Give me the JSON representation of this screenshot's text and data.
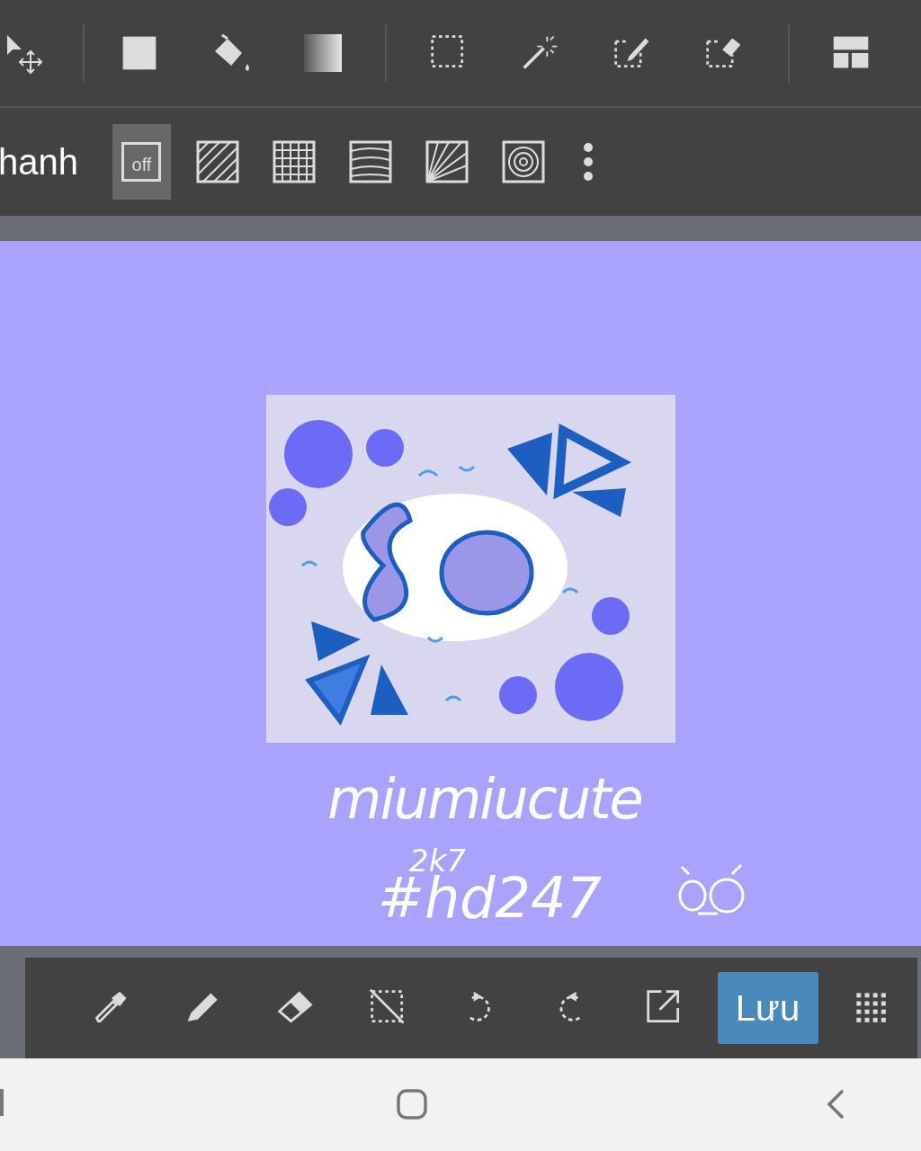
{
  "top_toolbar": {
    "groups": [
      {
        "tools": [
          {
            "kind": "move"
          }
        ]
      },
      {
        "tools": [
          {
            "kind": "fill-rect"
          },
          {
            "kind": "bucket"
          },
          {
            "kind": "gradient"
          }
        ]
      },
      {
        "tools": [
          {
            "kind": "select-rect"
          },
          {
            "kind": "magic-wand"
          },
          {
            "kind": "select-pen"
          },
          {
            "kind": "select-eraser"
          }
        ]
      },
      {
        "tools": [
          {
            "kind": "layout"
          }
        ]
      }
    ]
  },
  "pattern_bar": {
    "label": "hanh",
    "tiles": [
      {
        "kind": "off",
        "text": "off",
        "selected": true
      },
      {
        "kind": "diagonal",
        "selected": false
      },
      {
        "kind": "grid",
        "selected": false
      },
      {
        "kind": "wavy",
        "selected": false
      },
      {
        "kind": "rays",
        "selected": false
      },
      {
        "kind": "rings",
        "selected": false
      }
    ]
  },
  "canvas": {
    "handwriting": [
      "miumiucute",
      "2k7",
      "#hd247"
    ]
  },
  "bottom_toolbar": {
    "buttons": [
      {
        "kind": "eyedropper"
      },
      {
        "kind": "pencil"
      },
      {
        "kind": "eraser"
      },
      {
        "kind": "deselect"
      },
      {
        "kind": "undo"
      },
      {
        "kind": "redo"
      },
      {
        "kind": "export"
      },
      {
        "kind": "save",
        "label": "Lưu"
      },
      {
        "kind": "apps"
      }
    ]
  }
}
